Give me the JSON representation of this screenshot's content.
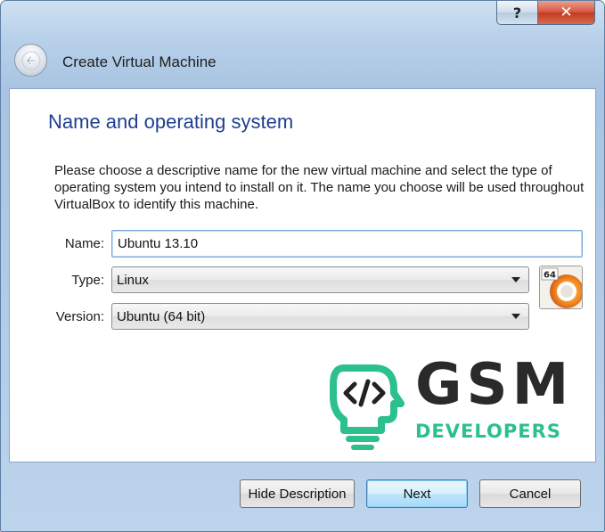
{
  "window": {
    "title": "Create Virtual Machine",
    "help_label": "?",
    "close_label": "✕"
  },
  "page": {
    "heading": "Name and operating system",
    "description": "Please choose a descriptive name for the new virtual machine and select the type of operating system you intend to install on it. The name you choose will be used throughout VirtualBox to identify this machine."
  },
  "form": {
    "name_label": "Name:",
    "name_value": "Ubuntu 13.10",
    "type_label": "Type:",
    "type_value": "Linux",
    "version_label": "Version:",
    "version_value": "Ubuntu (64 bit)",
    "os_icon_badge": "64"
  },
  "watermark": {
    "brand": "GSM",
    "subtitle": "DEVELOPERS",
    "color": "#2bc08c"
  },
  "buttons": {
    "hide_description": "Hide Description",
    "next": "Next",
    "cancel": "Cancel"
  },
  "icons": {
    "back": "back-arrow-icon",
    "os": "ubuntu-64-os-icon",
    "logo": "head-code-icon"
  }
}
